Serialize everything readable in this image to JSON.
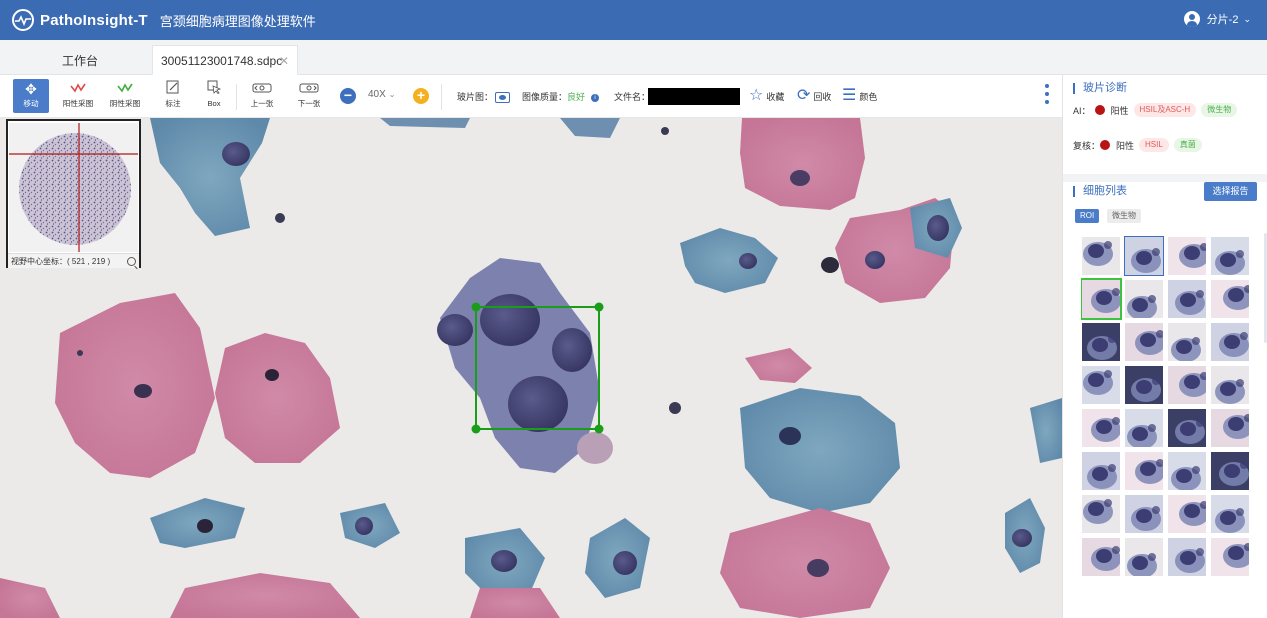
{
  "header": {
    "app_name": "PathoInsight-T",
    "app_subtitle": "宫颈细胞病理图像处理软件",
    "user_name": "分片-2"
  },
  "tabs": [
    {
      "label": "工作台"
    },
    {
      "label": "30051123001748.sdpc"
    }
  ],
  "toolbar": {
    "tools": [
      {
        "label": "移动",
        "icon": "move-icon",
        "active": true
      },
      {
        "label": "阳性采图",
        "icon": "positive-sample-icon",
        "active": false
      },
      {
        "label": "阴性采图",
        "icon": "negative-sample-icon",
        "active": false
      },
      {
        "label": "标注",
        "icon": "annotate-icon",
        "active": false
      },
      {
        "label": "Box",
        "icon": "box-cursor-icon",
        "active": false
      },
      {
        "label": "上一张",
        "icon": "prev-slide-icon",
        "active": false
      },
      {
        "label": "下一张",
        "icon": "next-slide-icon",
        "active": false
      }
    ],
    "zoom": "40X",
    "slide_thumb_label": "玻片图：",
    "quality_label": "图像质量：",
    "quality_value": "良好",
    "filename_label": "文件名：",
    "favorite_label": "收藏",
    "recycle_label": "回收",
    "color_label": "颜色"
  },
  "minimap": {
    "center_label": "视野中心坐标：",
    "center_value": "( 521 , 219 )"
  },
  "diagnosis": {
    "title": "玻片诊断",
    "ai_label": "AI：",
    "ai_result": "阳性",
    "ai_tags": [
      "HSIL及ASC-H",
      "微生物"
    ],
    "review_label": "复核：",
    "review_result": "阳性",
    "review_tags": [
      "HSIL",
      "真菌"
    ]
  },
  "cell_list": {
    "title": "细胞列表",
    "report_button": "选择报告",
    "filters": [
      "ROI",
      "微生物"
    ]
  },
  "colors": {
    "header_bg": "#3b6bb3",
    "accent": "#3d6fbd",
    "roi_box": "#1a9e1a",
    "positive_dot": "#b81414"
  }
}
